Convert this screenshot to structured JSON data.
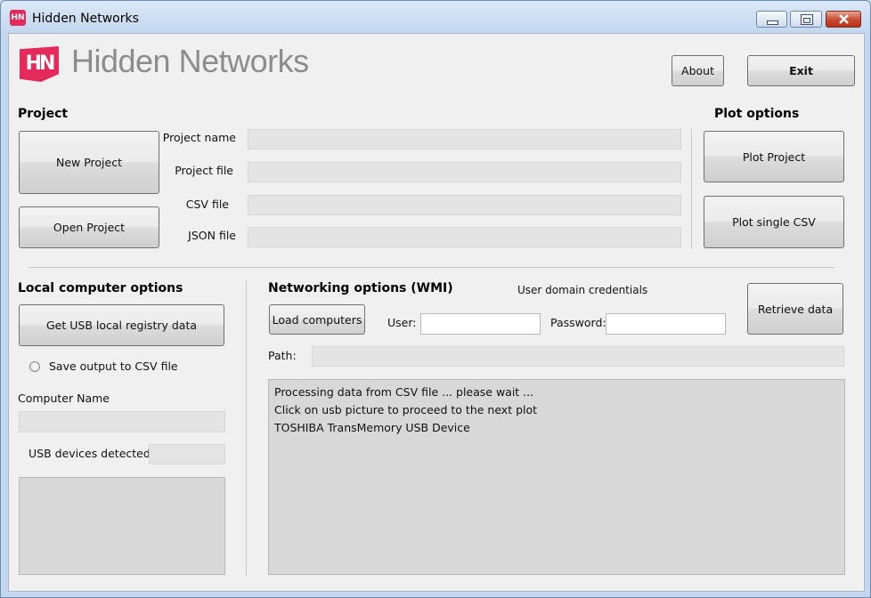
{
  "window": {
    "title": "Hidden Networks",
    "app_icon_text": "HN"
  },
  "logo": {
    "mark": "HN",
    "text": "Hidden Networks",
    "color": "#e32a5a"
  },
  "buttons": {
    "about": "About",
    "exit": "Exit"
  },
  "project": {
    "header": "Project",
    "new_button": "New Project",
    "open_button": "Open Project",
    "fields": [
      {
        "label": "Project name",
        "value": ""
      },
      {
        "label": "Project file",
        "value": ""
      },
      {
        "label": "CSV file",
        "value": ""
      },
      {
        "label": "JSON file",
        "value": ""
      }
    ]
  },
  "plot": {
    "header": "Plot options",
    "plot_project": "Plot Project",
    "plot_single": "Plot single CSV"
  },
  "local": {
    "header": "Local computer options",
    "get_usb_button": "Get USB local registry data",
    "save_csv_label": "Save output to CSV file",
    "computer_name_label": "Computer Name",
    "computer_name_value": "",
    "usb_detected_label": "USB devices detected:",
    "usb_detected_value": ""
  },
  "networking": {
    "header": "Networking options (WMI)",
    "credentials_label": "User domain credentials",
    "load_computers": "Load computers",
    "user_label": "User:",
    "user_value": "",
    "password_label": "Password:",
    "password_value": "",
    "retrieve_button": "Retrieve data",
    "path_label": "Path:",
    "path_value": "",
    "output_lines": [
      "Processing data from CSV file ... please wait ...",
      "Click on usb picture to proceed to the next plot",
      "TOSHIBA TransMemory USB Device"
    ]
  },
  "icons": [
    "minimize-icon",
    "maximize-icon",
    "close-icon",
    "radio-icon"
  ]
}
